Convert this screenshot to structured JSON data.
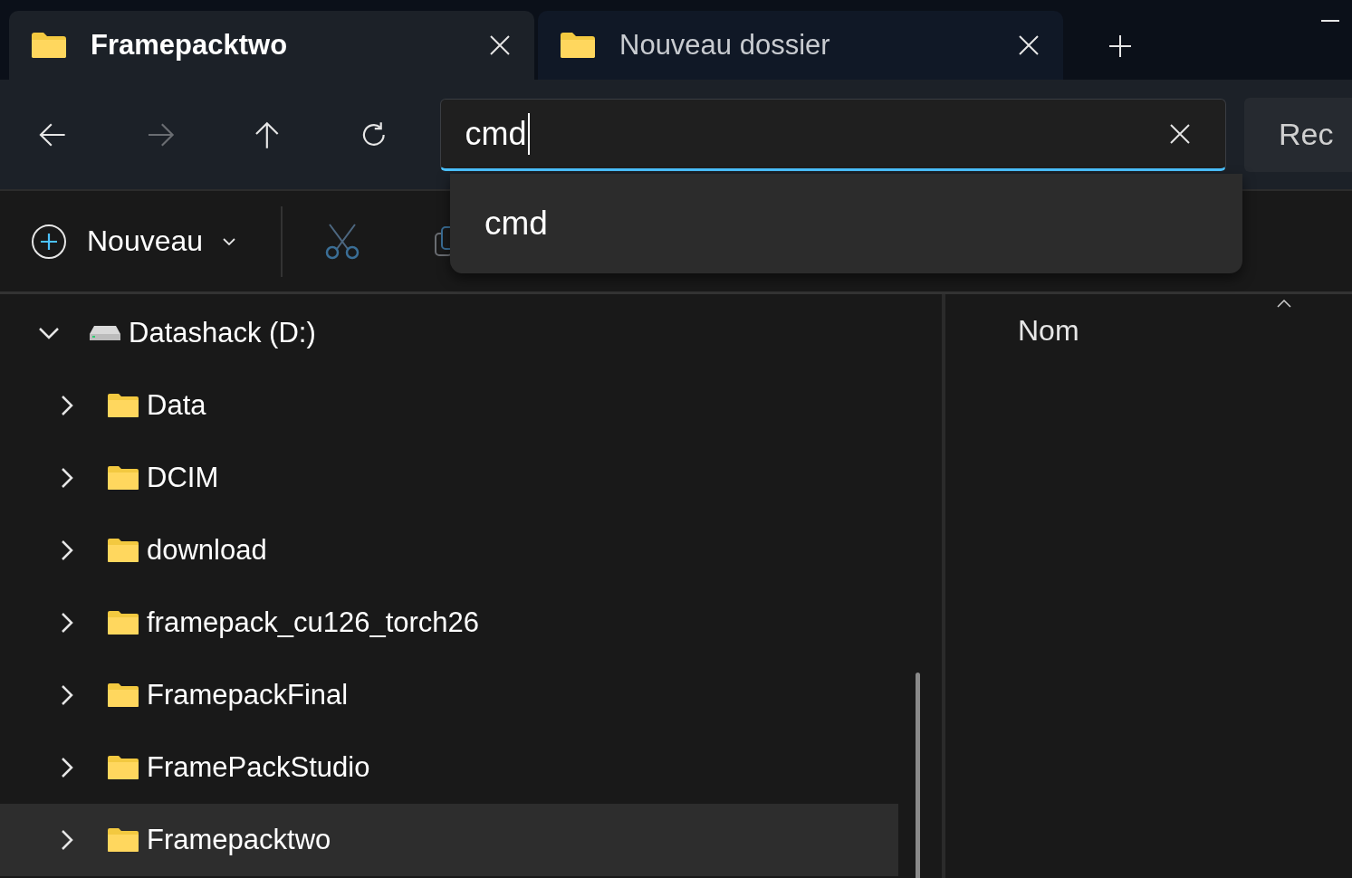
{
  "tabs": [
    {
      "label": "Framepacktwo",
      "selected": true
    },
    {
      "label": "Nouveau dossier",
      "selected": false
    }
  ],
  "navigation": {
    "forward_enabled": false
  },
  "search": {
    "value": "cmd",
    "suggestions": [
      {
        "label": "cmd"
      }
    ]
  },
  "side_button": {
    "label": "Rec"
  },
  "toolbar": {
    "new_label": "Nouveau"
  },
  "tree": {
    "label": "Datashack (D:)",
    "expanded": true,
    "children": [
      {
        "label": "Data",
        "expanded": false,
        "selected": false
      },
      {
        "label": "DCIM",
        "expanded": false,
        "selected": false
      },
      {
        "label": "download",
        "expanded": false,
        "selected": false
      },
      {
        "label": "framepack_cu126_torch26",
        "expanded": false,
        "selected": false
      },
      {
        "label": "FramepackFinal",
        "expanded": false,
        "selected": false
      },
      {
        "label": "FramePackStudio",
        "expanded": false,
        "selected": false
      },
      {
        "label": "Framepacktwo",
        "expanded": false,
        "selected": true
      }
    ]
  },
  "details": {
    "columns": [
      {
        "label": "Nom"
      }
    ]
  }
}
